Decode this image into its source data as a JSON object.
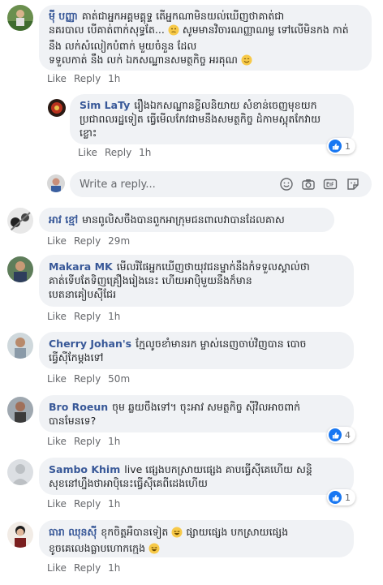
{
  "actions": {
    "like": "Like",
    "reply": "Reply"
  },
  "comments": [
    {
      "author": "ម៉ី បញ្ញា",
      "line1": "គាត់ជាអ្នកអគ្គមគ្គុទ្ទ តើអ្នកណាមិនយល់ឃើញថាគាត់ជា",
      "line2": "នគរបាល បើគាត់ពាក់សុទ្ធតែ...",
      "line3": "សូមមានវិចារណញ្ញាណម្ល  ទៅលើមិនកង កាត់ នឹង លក់សំលៀកបំពាក់ មួយចំនួន ដែល",
      "line4": "ទទួលកាត់ នឹង លក់ ឯកសណ្ឋានសមត្ថកិច្ច អរគុណ",
      "time": "1h"
    },
    {
      "author": "Sim LaTy",
      "line1": "រឿងឯកសណ្ឋានខ្លីលនិយាយ សំខាន់ចេញមុខយក",
      "line2": "ប្រជាពលរដ្ឋទៀត ធ្វើមើលកែវជាមនឹងសមត្ថកិច្ច ដំកាមស្អុតកែវាយ",
      "line3": "ខ្លោះ",
      "time": "1h",
      "reactions": "1"
    },
    {
      "author": "អាវ ខ្មៅ",
      "line1": "មានពូលិសចឹងបានពួកអាក្រុមជនពាលវាបានដែលគាស",
      "time": "29m"
    },
    {
      "author": "Makara MK",
      "line1": "មើលរីផែអ្នកឃើញថាយុវជនម្នាក់នឹងកំទទួលស្គាល់ថា",
      "line2": "គាត់ទើបតែទិញគ្រឿងរៀងនេះ ហើយអាប៉ិមួយនឹងក៏មាន",
      "line3": "បេតនាគៀបស៊ីជែរ",
      "time": "1h"
    },
    {
      "author": "Cherry Johan's",
      "line1": "ក្មែលូចខាំមានរក ម្ចាស់នេញចាប់វិញបាន បោច",
      "line2": "ធ្វើស៊ីកែម្តងទៅ",
      "time": "50m"
    },
    {
      "author": "Bro Roeun",
      "line1": "ចុម ឆ្លយចឹងទៅ។ ចុះអាវ សមត្ថកិច្ច ស៊ីវិលអាចពាក់",
      "line2": "បានមែនទេ?",
      "time": "1h",
      "reactions": "4"
    },
    {
      "author": "Sambo Khim",
      "line1": "live ផ្សេងបកស្រាយផ្សេង គាបធ្វើស៊ីគេហើយ សន្តិ",
      "line2": "សុខនៅហ្នឹងថាអាប៉ិនេះធ្វើស៊ីគេពីដេងហើយ",
      "time": "1h",
      "reactions": "1"
    },
    {
      "author": "ធារា ឈុនស៊ី",
      "line1": "ខុកចិត្តអឺបានទៀត",
      "line1b": "ផ្សាយផ្សេង បកស្រាយផ្សេង",
      "line2": "ខូចគេលេងធ្លាបហោកក្មេង",
      "time": "1h"
    }
  ],
  "reply_box": {
    "placeholder": "Write a reply..."
  },
  "colors": {
    "name": "#385898",
    "meta": "#65676b",
    "bubble": "#f0f2f5",
    "like": "#1877f2"
  }
}
